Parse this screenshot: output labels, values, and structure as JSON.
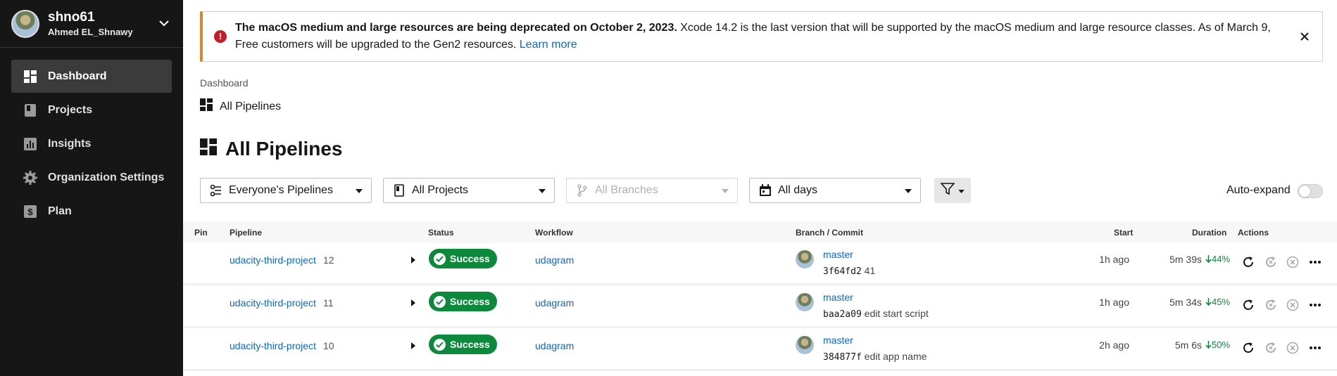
{
  "account": {
    "name": "shno61",
    "subtitle": "Ahmed EL_Shnawy"
  },
  "sidebar": {
    "items": [
      {
        "label": "Dashboard",
        "icon": "dashboard-icon",
        "active": true
      },
      {
        "label": "Projects",
        "icon": "projects-icon"
      },
      {
        "label": "Insights",
        "icon": "insights-icon"
      },
      {
        "label": "Organization Settings",
        "icon": "gear-icon"
      },
      {
        "label": "Plan",
        "icon": "plan-icon"
      }
    ]
  },
  "banner": {
    "bold": "The macOS medium and large resources are being deprecated on October 2, 2023.",
    "text": " Xcode 14.2 is the last version that will be supported by the macOS medium and large resource classes. As of March 9, Free customers will be upgraded to the Gen2 resources. ",
    "link": "Learn more"
  },
  "breadcrumb": {
    "root": "Dashboard",
    "current": "All Pipelines"
  },
  "page_title": "All Pipelines",
  "filters": {
    "pipelines": "Everyone's Pipelines",
    "projects": "All Projects",
    "branches": "All Branches",
    "days": "All days"
  },
  "auto_expand_label": "Auto-expand",
  "table": {
    "headers": {
      "pin": "Pin",
      "pipeline": "Pipeline",
      "status": "Status",
      "workflow": "Workflow",
      "branch_commit": "Branch / Commit",
      "start": "Start",
      "duration": "Duration",
      "actions": "Actions"
    },
    "rows": [
      {
        "pipeline": "udacity-third-project",
        "number": "12",
        "status": "Success",
        "workflow": "udagram",
        "branch": "master",
        "hash": "3f64fd2",
        "message": " 41",
        "start": "1h ago",
        "duration": "5m 39s",
        "change": "44%"
      },
      {
        "pipeline": "udacity-third-project",
        "number": "11",
        "status": "Success",
        "workflow": "udagram",
        "branch": "master",
        "hash": "baa2a09",
        "message": " edit start script",
        "start": "1h ago",
        "duration": "5m 34s",
        "change": "45%"
      },
      {
        "pipeline": "udacity-third-project",
        "number": "10",
        "status": "Success",
        "workflow": "udagram",
        "branch": "master",
        "hash": "384877f",
        "message": " edit app name",
        "start": "2h ago",
        "duration": "5m 6s",
        "change": "50%"
      }
    ]
  },
  "colors": {
    "success": "#0c8a3b",
    "link": "#0a67c9",
    "sidebar": "#161616",
    "error": "#c41e28",
    "warning_border": "#d48a2a"
  }
}
